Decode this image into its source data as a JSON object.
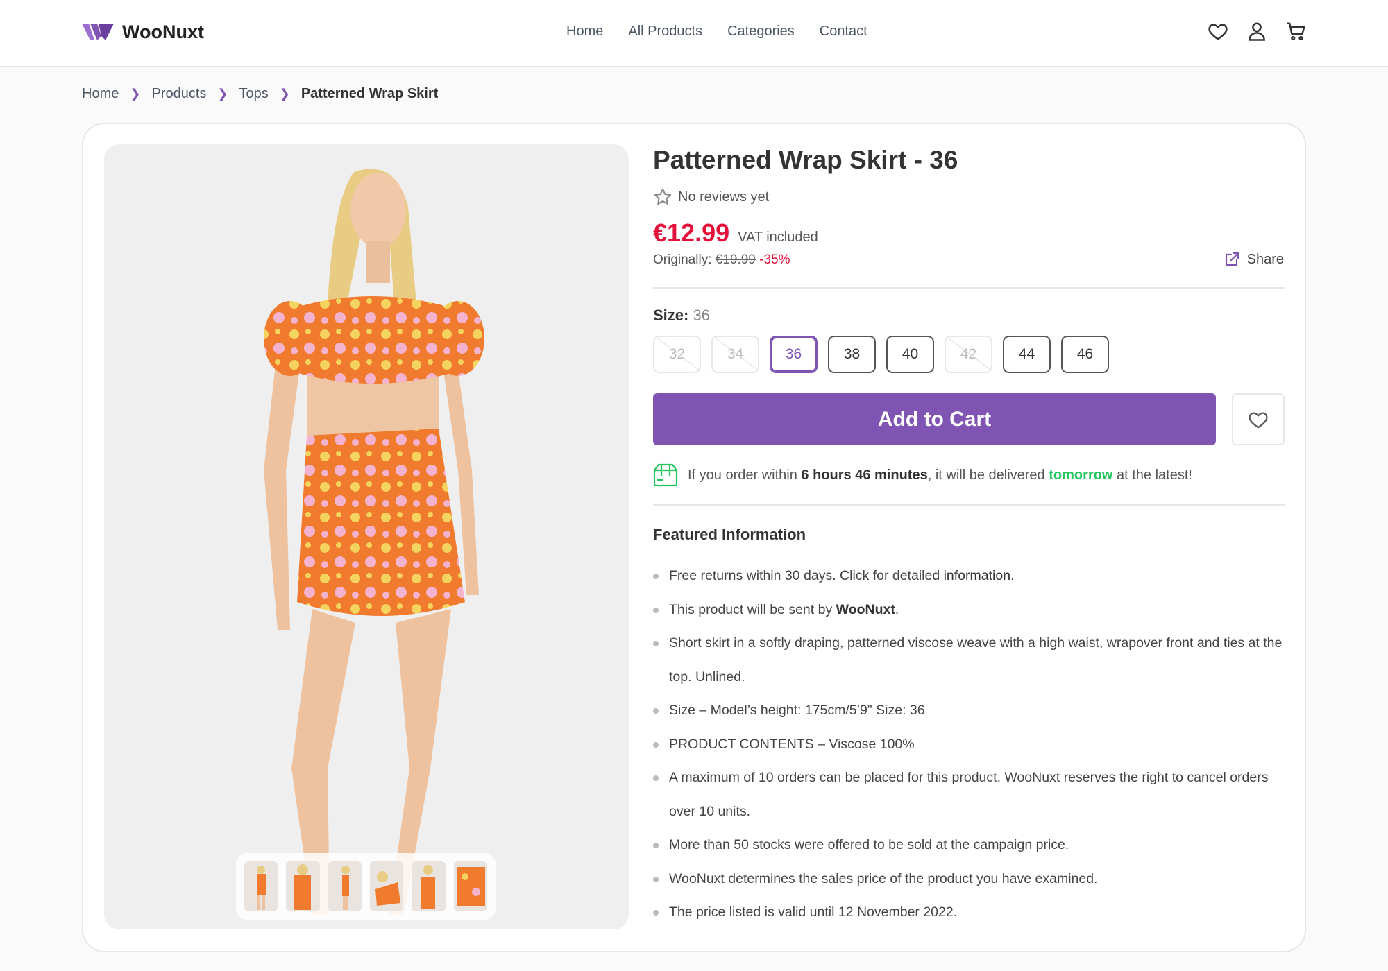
{
  "header": {
    "logo_text": "WooNuxt",
    "nav": [
      "Home",
      "All Products",
      "Categories",
      "Contact"
    ],
    "icons": [
      "heart-icon",
      "user-icon",
      "cart-icon"
    ],
    "brand_color": "#7f54b3"
  },
  "breadcrumb": [
    "Home",
    "Products",
    "Tops",
    "Patterned Wrap Skirt"
  ],
  "product": {
    "title": "Patterned Wrap Skirt - 36",
    "reviews_text": "No reviews yet",
    "price": "€12.99",
    "vat": "VAT included",
    "original_label": "Originally:",
    "original_price": "€19.99",
    "discount": "-35%",
    "share_label": "Share",
    "size_label": "Size:",
    "size_value": "36",
    "sizes": [
      {
        "label": "32",
        "state": "disabled"
      },
      {
        "label": "34",
        "state": "disabled"
      },
      {
        "label": "36",
        "state": "selected"
      },
      {
        "label": "38",
        "state": "available"
      },
      {
        "label": "40",
        "state": "available"
      },
      {
        "label": "42",
        "state": "disabled"
      },
      {
        "label": "44",
        "state": "available"
      },
      {
        "label": "46",
        "state": "available"
      }
    ],
    "add_to_cart": "Add to Cart",
    "thumbnail_count": 6
  },
  "delivery": {
    "prefix": "If you order within",
    "time": "6 hours 46 minutes",
    "middle": ", it will be delivered",
    "day": "tomorrow",
    "suffix": "at the latest!"
  },
  "featured": {
    "title": "Featured Information",
    "items": {
      "returns_prefix": "Free returns within 30 days. Click for detailed",
      "returns_link": "information",
      "sent_prefix": "This product will be sent by",
      "sent_link": "WooNuxt",
      "desc": "Short skirt in a softly draping, patterned viscose weave with a high waist, wrapover front and ties at the top. Unlined.",
      "size": "Size – Model’s height: 175cm/5’9\" Size: 36",
      "contents": "PRODUCT CONTENTS – Viscose 100%",
      "max_orders": "A maximum of 10 orders can be placed for this product. WooNuxt reserves the right to cancel orders over 10 units.",
      "stocks": "More than 50 stocks were offered to be sold at the campaign price.",
      "pricing": "WooNuxt determines the sales price of the product you have examined.",
      "valid": "The price listed is valid until 12 November 2022."
    }
  }
}
